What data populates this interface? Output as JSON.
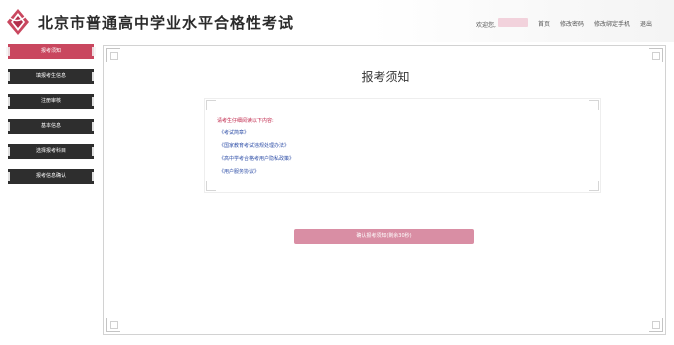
{
  "header": {
    "title": "北京市普通高中学业水平合格性考试",
    "welcome_label": "欢迎您,",
    "nav": [
      "首页",
      "修改密码",
      "修改绑定手机",
      "退出"
    ]
  },
  "sidebar": {
    "items": [
      {
        "label": "报考须知",
        "active": true
      },
      {
        "label": "填报考生信息",
        "active": false
      },
      {
        "label": "注册审核",
        "active": false
      },
      {
        "label": "基本信息",
        "active": false
      },
      {
        "label": "选择报考科目",
        "active": false
      },
      {
        "label": "报考信息确认",
        "active": false
      }
    ]
  },
  "main": {
    "page_title": "报考须知",
    "notice_heading": "请考生仔细阅读以下内容:",
    "notice_links": [
      "《考试简章》",
      "《国家教育考试违规处理办法》",
      "《高中学考合格考用户隐私政策》",
      "《用户服务协议》"
    ],
    "confirm_label": "确认报考须知(剩余30秒)"
  },
  "colors": {
    "accent": "#c9475f",
    "confirm_button": "#d98ea4",
    "link": "#3050a8",
    "notice_heading": "#c0264a"
  }
}
